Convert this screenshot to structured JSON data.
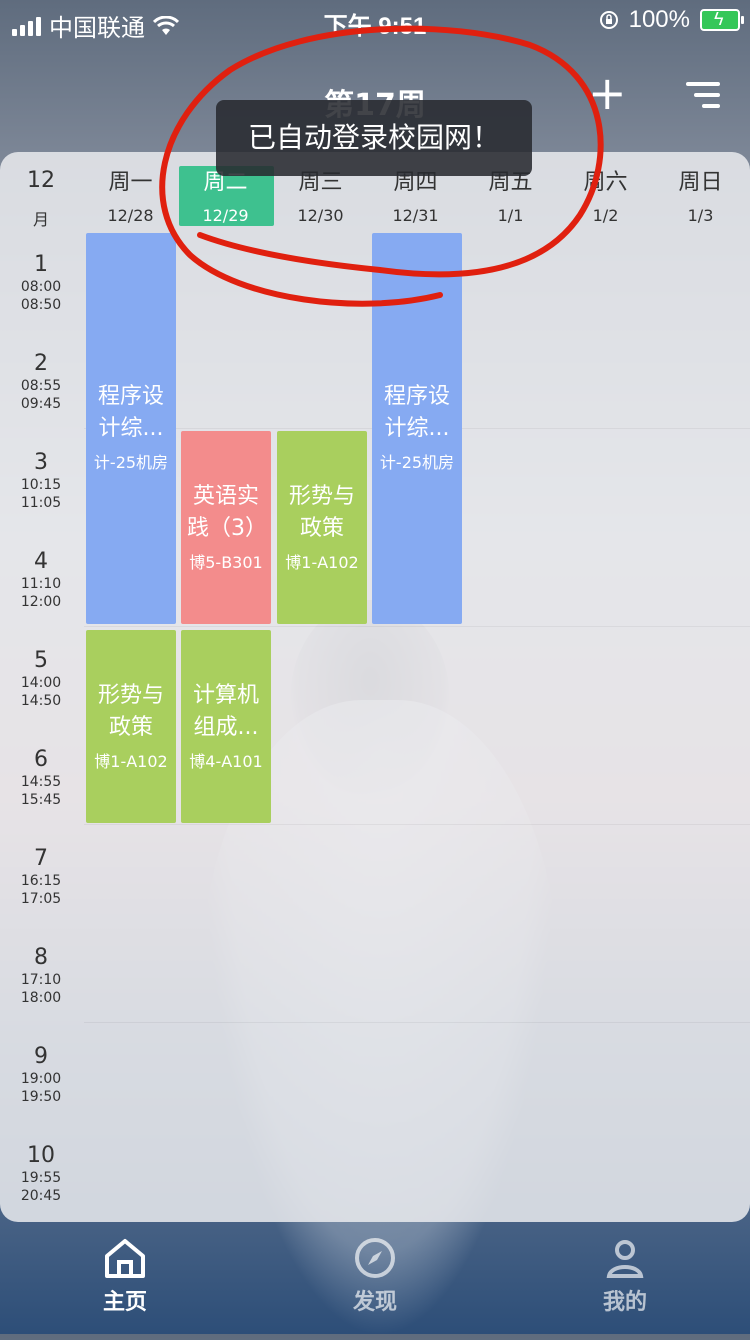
{
  "status_bar": {
    "carrier": "中国联通",
    "time": "下午 9:51",
    "battery": "100%"
  },
  "header": {
    "week_title": "第17周",
    "add_icon": "plus-icon",
    "menu_icon": "menu-icon"
  },
  "toast": {
    "message": "已自动登录校园网！"
  },
  "schedule": {
    "month": "12",
    "month_unit": "月",
    "days": [
      {
        "name": "周一",
        "date": "12/28"
      },
      {
        "name": "周二",
        "date": "12/29"
      },
      {
        "name": "周三",
        "date": "12/30"
      },
      {
        "name": "周四",
        "date": "12/31"
      },
      {
        "name": "周五",
        "date": "1/1"
      },
      {
        "name": "周六",
        "date": "1/2"
      },
      {
        "name": "周日",
        "date": "1/3"
      }
    ],
    "periods": [
      {
        "n": "1",
        "start": "08:00",
        "end": "08:50"
      },
      {
        "n": "2",
        "start": "08:55",
        "end": "09:45"
      },
      {
        "n": "3",
        "start": "10:15",
        "end": "11:05"
      },
      {
        "n": "4",
        "start": "11:10",
        "end": "12:00"
      },
      {
        "n": "5",
        "start": "14:00",
        "end": "14:50"
      },
      {
        "n": "6",
        "start": "14:55",
        "end": "15:45"
      },
      {
        "n": "7",
        "start": "16:15",
        "end": "17:05"
      },
      {
        "n": "8",
        "start": "17:10",
        "end": "18:00"
      },
      {
        "n": "9",
        "start": "19:00",
        "end": "19:50"
      },
      {
        "n": "10",
        "start": "19:55",
        "end": "20:45"
      }
    ],
    "courses": [
      {
        "name_1": "程序设",
        "name_2": "计综...",
        "room": "计-25机房"
      },
      {
        "name_1": "程序设",
        "name_2": "计综...",
        "room": "计-25机房"
      },
      {
        "name_1": "英语实",
        "name_2": "践（3）",
        "room": "博5-B301"
      },
      {
        "name_1": "形势与",
        "name_2": "政策",
        "room": "博1-A102"
      },
      {
        "name_1": "形势与",
        "name_2": "政策",
        "room": "博1-A102"
      },
      {
        "name_1": "计算机",
        "name_2": "组成...",
        "room": "博4-A101"
      }
    ]
  },
  "tabbar": {
    "items": [
      {
        "label": "主页",
        "icon": "home-icon"
      },
      {
        "label": "发现",
        "icon": "compass-icon"
      },
      {
        "label": "我的",
        "icon": "person-icon"
      }
    ]
  },
  "colors": {
    "today": "#3ec18f",
    "course_blue": "#86aaf2",
    "course_red": "#f38c8c",
    "course_green": "#a9cf5e",
    "annotation": "#e0200f"
  }
}
